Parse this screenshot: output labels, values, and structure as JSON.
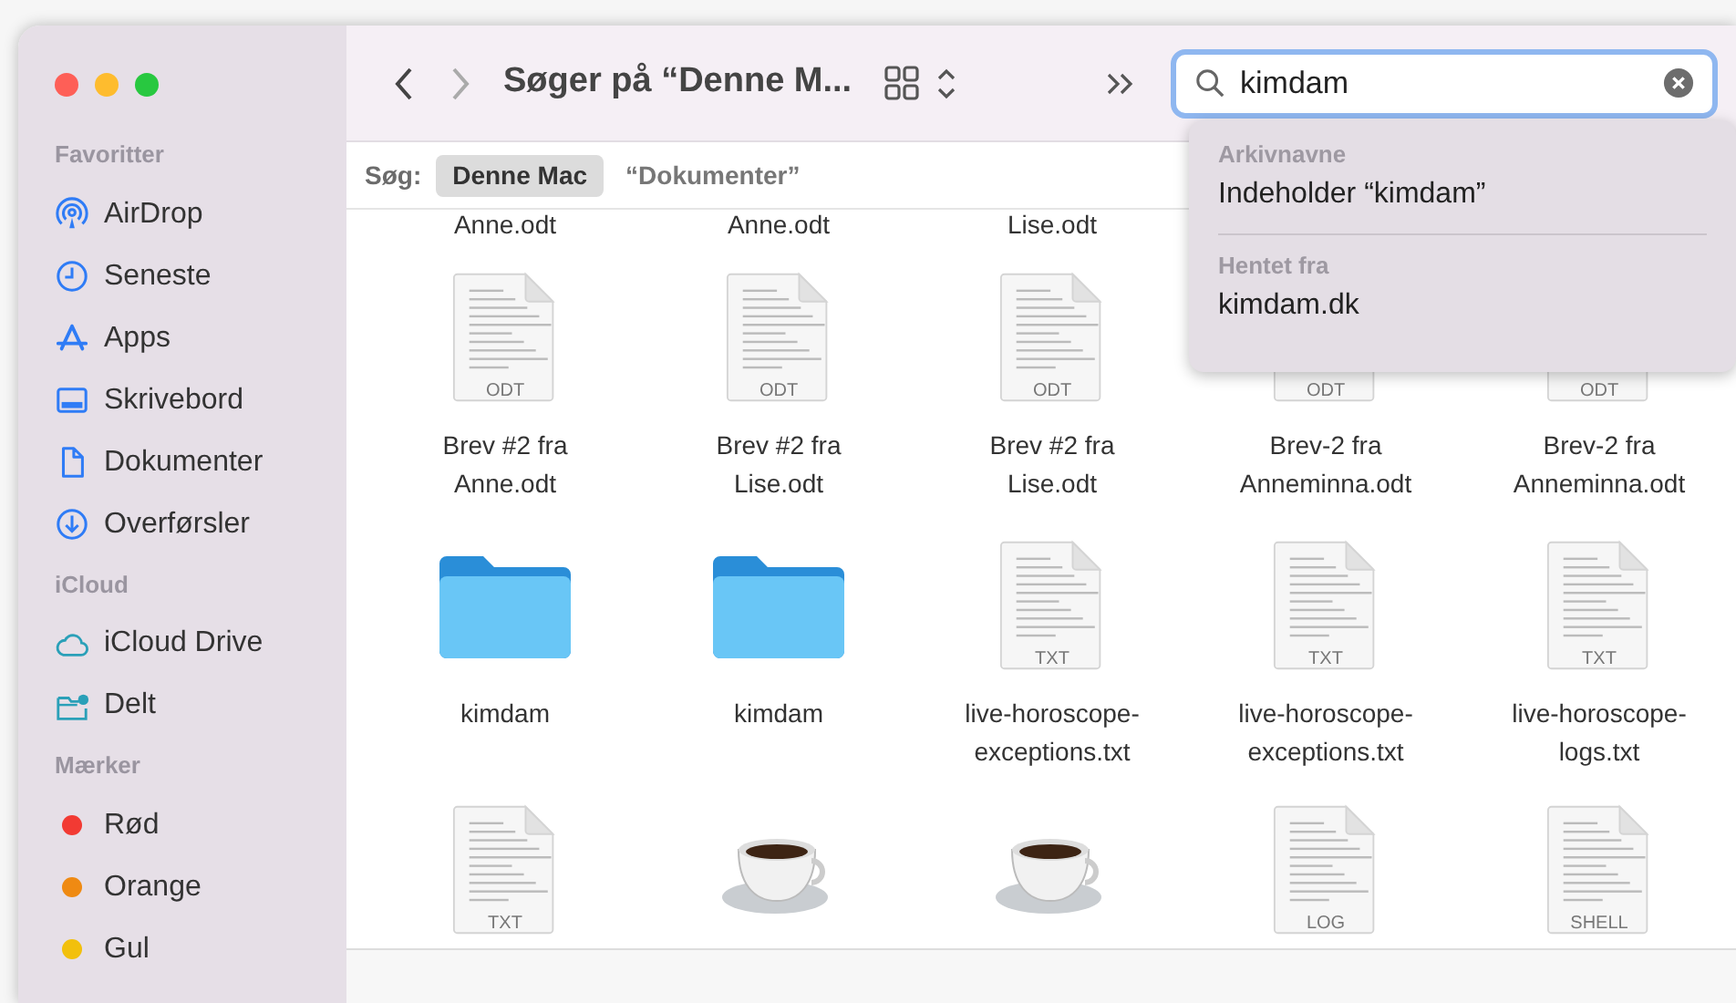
{
  "window": {
    "title": "Søger på “Denne M..."
  },
  "sidebar": {
    "sections": [
      {
        "heading": "Favoritter",
        "items": [
          {
            "label": "AirDrop",
            "kind": "place"
          },
          {
            "label": "Seneste",
            "kind": "place"
          },
          {
            "label": "Apps",
            "kind": "place"
          },
          {
            "label": "Skrivebord",
            "kind": "place"
          },
          {
            "label": "Dokumenter",
            "kind": "place"
          },
          {
            "label": "Overførsler",
            "kind": "place"
          }
        ]
      },
      {
        "heading": "iCloud",
        "items": [
          {
            "label": "iCloud Drive",
            "kind": "place"
          },
          {
            "label": "Delt",
            "kind": "place"
          }
        ]
      },
      {
        "heading": "Mærker",
        "items": [
          {
            "label": "Rød",
            "kind": "tag",
            "color": "#f23a33"
          },
          {
            "label": "Orange",
            "kind": "tag",
            "color": "#ef8a12"
          },
          {
            "label": "Gul",
            "kind": "tag",
            "color": "#f2c00c"
          }
        ]
      }
    ]
  },
  "search": {
    "value": "kimdam"
  },
  "scope_bar": {
    "label": "Søg:",
    "scopes": [
      {
        "label": "Denne Mac",
        "selected": true
      },
      {
        "label": "“Dokumenter”",
        "selected": false
      }
    ]
  },
  "files": [
    [
      {
        "name": "Anne.odt"
      },
      {
        "name": "Anne.odt"
      },
      {
        "name": "Lise.odt"
      }
    ],
    [
      {
        "kind": "document",
        "type_label": "ODT",
        "name": "Brev #2 fra Anne.odt"
      },
      {
        "kind": "document",
        "type_label": "ODT",
        "name": "Brev #2 fra Lise.odt"
      },
      {
        "kind": "document",
        "type_label": "ODT",
        "name": "Brev #2 fra Lise.odt"
      },
      {
        "kind": "document",
        "type_label": "ODT",
        "name": "Brev-2 fra Anneminna.odt"
      },
      {
        "kind": "document",
        "type_label": "ODT",
        "name": "Brev-2 fra Anneminna.odt"
      }
    ],
    [
      {
        "kind": "folder",
        "name": "kimdam"
      },
      {
        "kind": "folder",
        "name": "kimdam"
      },
      {
        "kind": "document",
        "type_label": "TXT",
        "name": "live-horoscope-exceptions.txt"
      },
      {
        "kind": "document",
        "type_label": "TXT",
        "name": "live-horoscope-exceptions.txt"
      },
      {
        "kind": "document",
        "type_label": "TXT",
        "name": "live-horoscope-logs.txt"
      }
    ],
    [
      {
        "kind": "document",
        "type_label": "TXT"
      },
      {
        "kind": "coffee"
      },
      {
        "kind": "coffee"
      },
      {
        "kind": "document",
        "type_label": "LOG"
      },
      {
        "kind": "document",
        "type_label": "SHELL"
      }
    ]
  ],
  "suggestions": {
    "sections": [
      {
        "heading": "Arkivnavne",
        "items": [
          "Indeholder “kimdam”"
        ]
      },
      {
        "heading": "Hentet fra",
        "items": [
          "kimdam.dk"
        ]
      }
    ]
  }
}
